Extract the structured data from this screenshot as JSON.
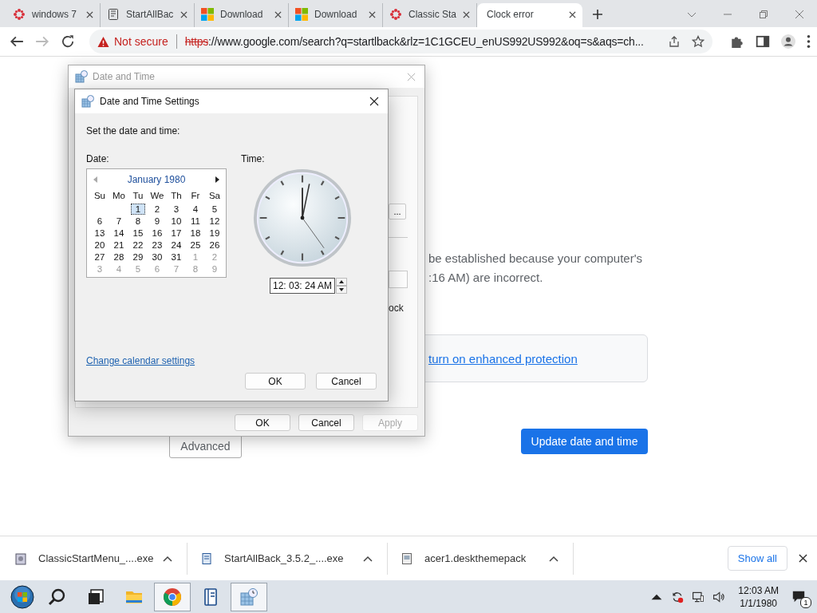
{
  "browser": {
    "tabs": [
      {
        "title": "windows 7",
        "kind": "flower",
        "selected": false
      },
      {
        "title": "StartAllBac",
        "kind": "book",
        "selected": false
      },
      {
        "title": "Download",
        "kind": "windows",
        "selected": false
      },
      {
        "title": "Download",
        "kind": "windows",
        "selected": false
      },
      {
        "title": "Classic Sta",
        "kind": "flower",
        "selected": false
      },
      {
        "title": "Clock error",
        "kind": "plain",
        "selected": true
      }
    ],
    "security": "Not secure",
    "scheme": "https",
    "url": "://www.google.com/search?q=startlback&rlz=1C1GCEU_enUS992US992&oq=s&aqs=ch..."
  },
  "page": {
    "message_line_1": "be established because your computer's",
    "message_line_2": ":16 AM) are incorrect.",
    "protection_link": "turn on enhanced protection",
    "advanced_button": "Advanced",
    "update_button": "Update date and time"
  },
  "outer_dialog": {
    "title": "Date and Time",
    "partial_button": "...",
    "partial_label": "ock",
    "buttons": [
      {
        "label": "OK",
        "disabled": false
      },
      {
        "label": "Cancel",
        "disabled": false
      },
      {
        "label": "Apply",
        "disabled": true
      }
    ]
  },
  "inner_dialog": {
    "title": "Date and Time Settings",
    "prompt": "Set the date and time:",
    "date_label": "Date:",
    "time_label": "Time:",
    "calendar": {
      "month": "January 1980",
      "weekdays": [
        "Su",
        "Mo",
        "Tu",
        "We",
        "Th",
        "Fr",
        "Sa"
      ],
      "weeks": [
        {
          "days": [
            {
              "label": "1",
              "in_month": true,
              "selected": true
            },
            {
              "label": "2",
              "in_month": true,
              "selected": false
            },
            {
              "label": "3",
              "in_month": true,
              "selected": false
            },
            {
              "label": "4",
              "in_month": true,
              "selected": false
            },
            {
              "label": "5",
              "in_month": true,
              "selected": false
            }
          ]
        },
        {
          "days": [
            {
              "label": "6",
              "in_month": true,
              "selected": false
            },
            {
              "label": "7",
              "in_month": true,
              "selected": false
            },
            {
              "label": "8",
              "in_month": true,
              "selected": false
            },
            {
              "label": "9",
              "in_month": true,
              "selected": false
            },
            {
              "label": "10",
              "in_month": true,
              "selected": false
            },
            {
              "label": "11",
              "in_month": true,
              "selected": false
            },
            {
              "label": "12",
              "in_month": true,
              "selected": false
            }
          ]
        },
        {
          "days": [
            {
              "label": "13",
              "in_month": true,
              "selected": false
            },
            {
              "label": "14",
              "in_month": true,
              "selected": false
            },
            {
              "label": "15",
              "in_month": true,
              "selected": false
            },
            {
              "label": "16",
              "in_month": true,
              "selected": false
            },
            {
              "label": "17",
              "in_month": true,
              "selected": false
            },
            {
              "label": "18",
              "in_month": true,
              "selected": false
            },
            {
              "label": "19",
              "in_month": true,
              "selected": false
            }
          ]
        },
        {
          "days": [
            {
              "label": "20",
              "in_month": true,
              "selected": false
            },
            {
              "label": "21",
              "in_month": true,
              "selected": false
            },
            {
              "label": "22",
              "in_month": true,
              "selected": false
            },
            {
              "label": "23",
              "in_month": true,
              "selected": false
            },
            {
              "label": "24",
              "in_month": true,
              "selected": false
            },
            {
              "label": "25",
              "in_month": true,
              "selected": false
            },
            {
              "label": "26",
              "in_month": true,
              "selected": false
            }
          ]
        },
        {
          "days": [
            {
              "label": "27",
              "in_month": true,
              "selected": false
            },
            {
              "label": "28",
              "in_month": true,
              "selected": false
            },
            {
              "label": "29",
              "in_month": true,
              "selected": false
            },
            {
              "label": "30",
              "in_month": true,
              "selected": false
            },
            {
              "label": "31",
              "in_month": true,
              "selected": false
            },
            {
              "label": "1",
              "in_month": false,
              "selected": false
            },
            {
              "label": "2",
              "in_month": false,
              "selected": false
            }
          ]
        },
        {
          "days": [
            {
              "label": "3",
              "in_month": false,
              "selected": false
            },
            {
              "label": "4",
              "in_month": false,
              "selected": false
            },
            {
              "label": "5",
              "in_month": false,
              "selected": false
            },
            {
              "label": "6",
              "in_month": false,
              "selected": false
            },
            {
              "label": "7",
              "in_month": false,
              "selected": false
            },
            {
              "label": "8",
              "in_month": false,
              "selected": false
            },
            {
              "label": "9",
              "in_month": false,
              "selected": false
            }
          ]
        }
      ]
    },
    "time_value": "12: 03: 24 AM",
    "link": "Change calendar settings",
    "buttons": [
      "OK",
      "Cancel"
    ]
  },
  "downloads": {
    "items": [
      {
        "name": "ClassicStartMenu_....exe",
        "kind": "installer"
      },
      {
        "name": "StartAllBack_3.5.2_....exe",
        "kind": "book"
      },
      {
        "name": "acer1.deskthemepack",
        "kind": "theme"
      }
    ],
    "show_all": "Show all"
  },
  "taskbar": {
    "apps": [
      {
        "kind": "search",
        "active": false
      },
      {
        "kind": "taskview",
        "active": false
      },
      {
        "kind": "folder",
        "active": false
      },
      {
        "kind": "chrome",
        "active": true
      },
      {
        "kind": "book",
        "active": false
      },
      {
        "kind": "calendar",
        "active": true
      }
    ],
    "time": "12:03 AM",
    "date": "1/1/1980",
    "notifications": "1"
  }
}
